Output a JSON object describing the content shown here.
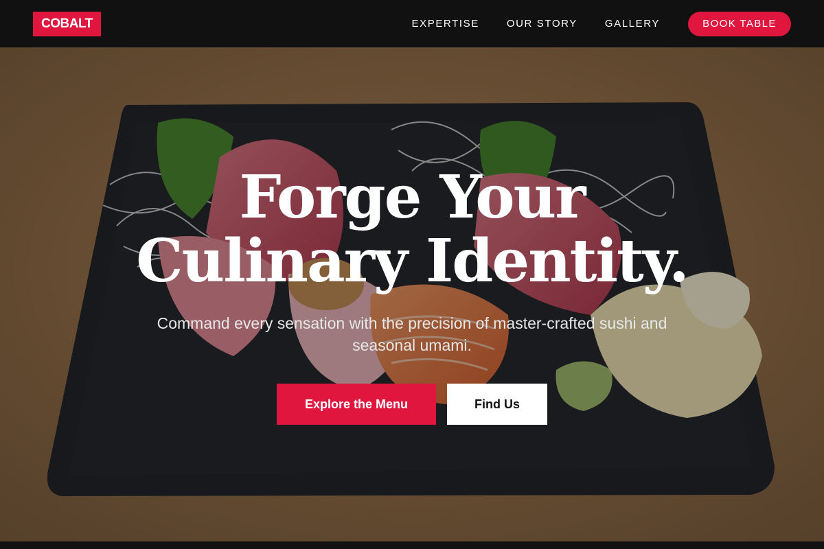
{
  "brand": {
    "logo": "COBALT",
    "accent_color": "#e0163f"
  },
  "nav": {
    "links": [
      {
        "label": "EXPERTISE"
      },
      {
        "label": "OUR STORY"
      },
      {
        "label": "GALLERY"
      }
    ],
    "cta": "BOOK TABLE"
  },
  "hero": {
    "headline_line1": "Forge Your",
    "headline_line2": "Culinary Identity.",
    "subtitle": "Command every sensation with the precision of master-crafted sushi and seasonal umami.",
    "primary_button": "Explore the Menu",
    "secondary_button": "Find Us",
    "background_image": "sashimi-on-slate-photo"
  }
}
